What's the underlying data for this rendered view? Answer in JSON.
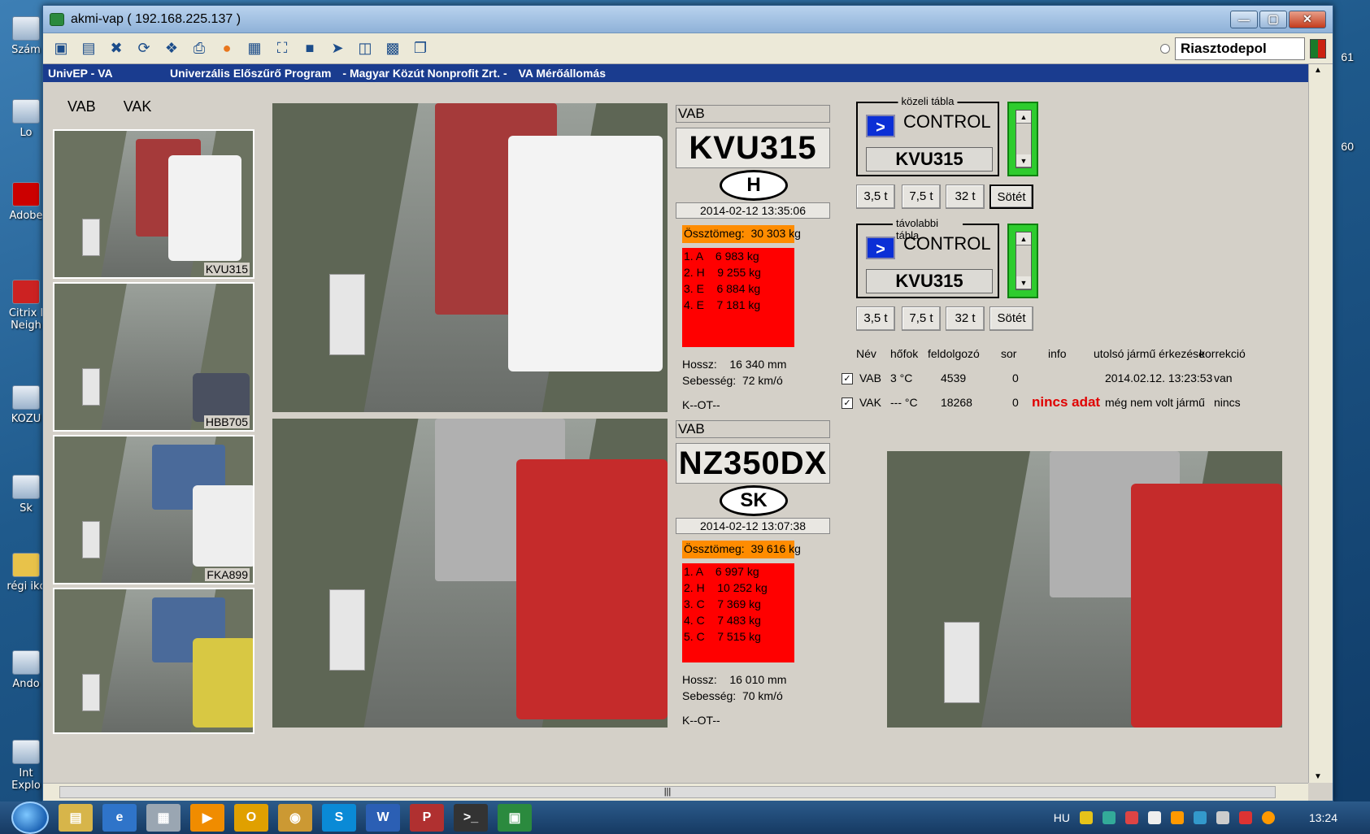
{
  "window": {
    "title": "akmi-vap ( 192.168.225.137 )"
  },
  "toolbar": {
    "selected_profile": "Riasztodepol"
  },
  "header": {
    "app": "UnivEP - VA",
    "program": "Univerzális Előszűrő Program",
    "org": "- Magyar Közút Nonprofit Zrt. -",
    "station": "VA Mérőállomás"
  },
  "lanes": {
    "tab1": "VAB",
    "tab2": "VAK"
  },
  "thumbnails": [
    {
      "plate": "KVU315"
    },
    {
      "plate": "HBB705"
    },
    {
      "plate": "FKA899"
    },
    {
      "plate": ""
    }
  ],
  "records": [
    {
      "lane": "VAB",
      "plate": "KVU315",
      "country": "H",
      "timestamp": "2014-02-12 13:35:06",
      "total": "Össztömeg:  30 303 kg",
      "axles": [
        "1. A    6 983 kg",
        "2. H    9 255 kg",
        "3. E    6 884 kg",
        "4. E    7 181 kg"
      ],
      "length": "Hossz:    16 340 mm",
      "speed": "Sebesség:  72 km/ó",
      "status": "K--OT--"
    },
    {
      "lane": "VAB",
      "plate": "NZ350DX",
      "country": "SK",
      "timestamp": "2014-02-12 13:07:38",
      "total": "Össztömeg:  39 616 kg",
      "axles": [
        "1. A    6 997 kg",
        "2. H    10 252 kg",
        "3. C    7 369 kg",
        "4. C    7 483 kg",
        "5. C    7 515 kg"
      ],
      "length": "Hossz:    16 010 mm",
      "speed": "Sebesség:  70 km/ó",
      "status": "K--OT--"
    }
  ],
  "boards": [
    {
      "caption": "közeli tábla",
      "text": "CONTROL",
      "plate": "KVU315",
      "buttons": [
        "3,5 t",
        "7,5 t",
        "32 t",
        "Sötét"
      ],
      "selected": "Sötét"
    },
    {
      "caption": "távolabbi tábla",
      "text": "CONTROL",
      "plate": "KVU315",
      "buttons": [
        "3,5 t",
        "7,5 t",
        "32 t",
        "Sötét"
      ],
      "selected": ""
    }
  ],
  "status_table": {
    "headers": {
      "name": "Név",
      "temp": "hőfok",
      "proc": "feldolgozó",
      "queue": "sor",
      "info": "info",
      "last": "utolsó jármű érkezése",
      "corr": "korrekció"
    },
    "rows": [
      {
        "checked": true,
        "name": "VAB",
        "temp": "3 °C",
        "proc": "4539",
        "queue": "0",
        "info": "",
        "last": "2014.02.12. 13:23:53",
        "corr": "van"
      },
      {
        "checked": true,
        "name": "VAK",
        "temp": "--- °C",
        "proc": "18268",
        "queue": "0",
        "info": "nincs adat",
        "last": "még nem volt jármű",
        "corr": "nincs"
      }
    ]
  },
  "desktop_icons": [
    "Szám",
    "Lo",
    "Adobe",
    "Citrix l Neigh",
    "KOZU",
    "Sk",
    "régi ikc",
    "Ando",
    "Int Explo"
  ],
  "desktop_right": [
    "61",
    "60"
  ],
  "taskbar": {
    "lang": "HU",
    "clock": "13:24"
  },
  "colors": {
    "total_bg": "#ff8c00",
    "axles_bg": "#ff0000",
    "board_arrow": "#0b2fd6",
    "header_strip": "#1a3c8f",
    "nodata": "#e00000"
  }
}
